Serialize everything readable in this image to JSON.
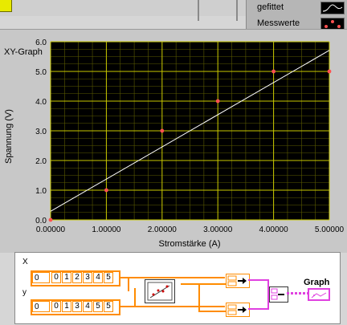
{
  "graph": {
    "title": "XY-Graph",
    "legend": [
      {
        "label": "gefittet",
        "style": "line"
      },
      {
        "label": "Messwerte",
        "style": "points"
      }
    ]
  },
  "chart_data": {
    "type": "scatter",
    "xlabel": "Stromstärke (A)",
    "ylabel": "Spannung (V)",
    "xlim": [
      0,
      5
    ],
    "ylim": [
      0,
      6
    ],
    "x_ticks": [
      "0.00000",
      "1.00000",
      "2.00000",
      "3.00000",
      "4.00000",
      "5.00000"
    ],
    "y_ticks": [
      "0.0",
      "1.0",
      "2.0",
      "3.0",
      "4.0",
      "5.0",
      "6.0"
    ],
    "grid": true,
    "series": [
      {
        "name": "Messwerte",
        "style": "points",
        "color": "#ff5050",
        "x": [
          0,
          1,
          2,
          3,
          4,
          5
        ],
        "y": [
          0,
          1,
          3,
          4,
          5,
          5
        ]
      },
      {
        "name": "gefittet",
        "style": "line",
        "color": "#ffffff",
        "x": [
          0,
          5
        ],
        "y": [
          0.29,
          5.71
        ]
      }
    ]
  },
  "block_diagram": {
    "x_label": "X",
    "y_label": "y",
    "x_index": "0",
    "y_index": "0",
    "x_values": [
      "0",
      "1",
      "2",
      "3",
      "4",
      "5"
    ],
    "y_values": [
      "0",
      "1",
      "3",
      "4",
      "5",
      "5"
    ],
    "graph_label": "Graph"
  },
  "colors": {
    "plot_bg": "#000000",
    "grid_major": "#c8c800",
    "grid_minor": "#5a5a00",
    "wire": "#ff8c00",
    "cluster": "#e040e0"
  }
}
